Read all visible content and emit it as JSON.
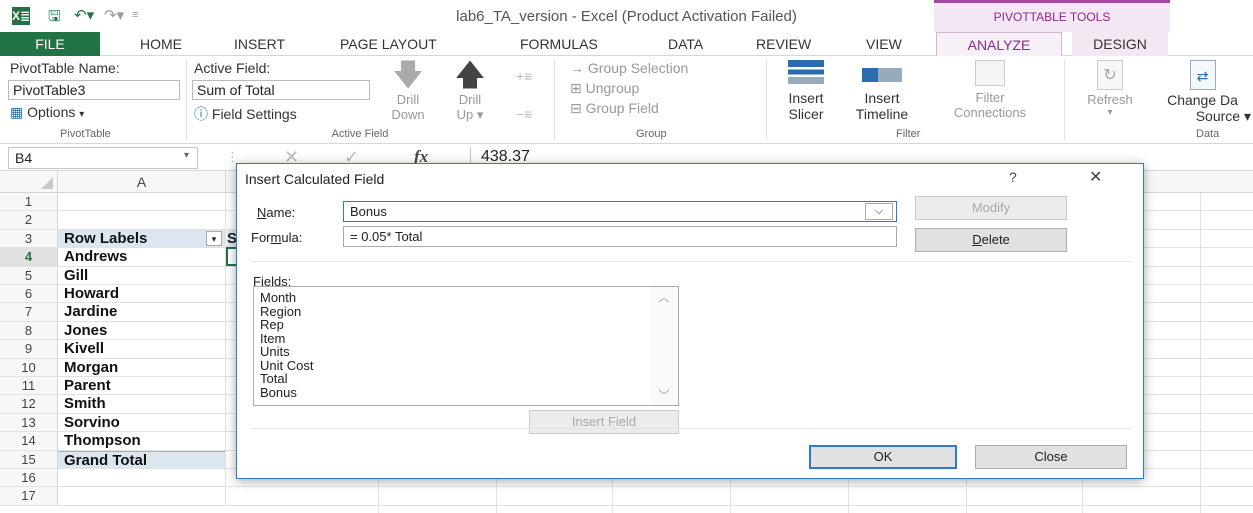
{
  "titlebar": {
    "app_icon": "X≣",
    "save_icon": "save-icon",
    "undo_icon": "undo-icon",
    "redo_icon": "redo-icon",
    "title": "lab6_TA_version - Excel (Product Activation Failed)",
    "context_tab_group": "PIVOTTABLE TOOLS"
  },
  "tabs": [
    "FILE",
    "HOME",
    "INSERT",
    "PAGE LAYOUT",
    "FORMULAS",
    "DATA",
    "REVIEW",
    "VIEW",
    "ANALYZE",
    "DESIGN"
  ],
  "ribbon": {
    "pivottable_name_label": "PivotTable Name:",
    "pivottable_name_value": "PivotTable3",
    "options_label": "Options",
    "pivottable_group": "PivotTable",
    "active_field_label": "Active Field:",
    "active_field_value": "Sum of Total",
    "field_settings_label": "Field Settings",
    "drill_down_label": [
      "Drill",
      "Down"
    ],
    "drill_up_label": [
      "Drill",
      "Up"
    ],
    "active_field_group": "Active Field",
    "group_selection": "Group Selection",
    "ungroup": "Ungroup",
    "group_field": "Group Field",
    "group_group": "Group",
    "insert_slicer": [
      "Insert",
      "Slicer"
    ],
    "insert_timeline": [
      "Insert",
      "Timeline"
    ],
    "filter_connections": [
      "Filter",
      "Connections"
    ],
    "filter_group": "Filter",
    "refresh": "Refresh",
    "change_data_source": [
      "Change Da",
      "Source"
    ],
    "data_group": "Data"
  },
  "formula_bar": {
    "name_box": "B4",
    "fx": "fx",
    "value": "438.37"
  },
  "grid": {
    "column_a": "A",
    "rows": [
      {
        "num": "1",
        "a": ""
      },
      {
        "num": "2",
        "a": ""
      },
      {
        "num": "3",
        "a": "Row Labels",
        "b": "S"
      },
      {
        "num": "4",
        "a": "Andrews"
      },
      {
        "num": "5",
        "a": "Gill"
      },
      {
        "num": "6",
        "a": "Howard"
      },
      {
        "num": "7",
        "a": "Jardine"
      },
      {
        "num": "8",
        "a": "Jones"
      },
      {
        "num": "9",
        "a": "Kivell"
      },
      {
        "num": "10",
        "a": "Morgan"
      },
      {
        "num": "11",
        "a": "Parent"
      },
      {
        "num": "12",
        "a": "Smith"
      },
      {
        "num": "13",
        "a": "Sorvino"
      },
      {
        "num": "14",
        "a": "Thompson"
      },
      {
        "num": "15",
        "a": "Grand Total"
      },
      {
        "num": "16",
        "a": ""
      },
      {
        "num": "17",
        "a": ""
      }
    ]
  },
  "dialog": {
    "title": "Insert Calculated Field",
    "help": "?",
    "close_glyph": "✕",
    "name_label": "Name:",
    "name_value": "Bonus",
    "formula_label": "Formula:",
    "formula_value": "= 0.05* Total",
    "modify_button": "Modify",
    "delete_button": "Delete",
    "fields_label": "Fields:",
    "fields": [
      "Month",
      "Region",
      "Rep",
      "Item",
      "Units",
      "Unit Cost",
      "Total",
      "Bonus"
    ],
    "insert_field_button": "Insert Field",
    "ok_button": "OK",
    "close_button": "Close"
  },
  "colors": {
    "excel_green": "#217346",
    "pivot_accent": "#a24aa2",
    "dialog_border": "#2b7bd3"
  }
}
